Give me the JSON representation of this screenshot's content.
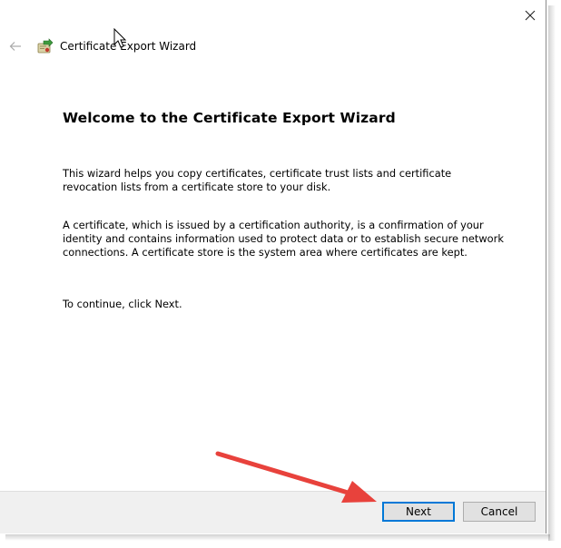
{
  "window": {
    "title": "Certificate Export Wizard",
    "close_icon": "close-icon",
    "back_icon": "back-arrow-icon",
    "title_icon": "certificate-icon"
  },
  "content": {
    "heading": "Welcome to the Certificate Export Wizard",
    "paragraph_1": "This wizard helps you copy certificates, certificate trust lists and certificate revocation lists from a certificate store to your disk.",
    "paragraph_2": "A certificate, which is issued by a certification authority, is a confirmation of your identity and contains information used to protect data or to establish secure network connections. A certificate store is the system area where certificates are kept.",
    "paragraph_3": "To continue, click Next."
  },
  "footer": {
    "next_label": "Next",
    "cancel_label": "Cancel"
  },
  "colors": {
    "annotation_arrow": "#e8423c",
    "default_button_border": "#0078d7",
    "footer_background": "#f0f0f0"
  }
}
